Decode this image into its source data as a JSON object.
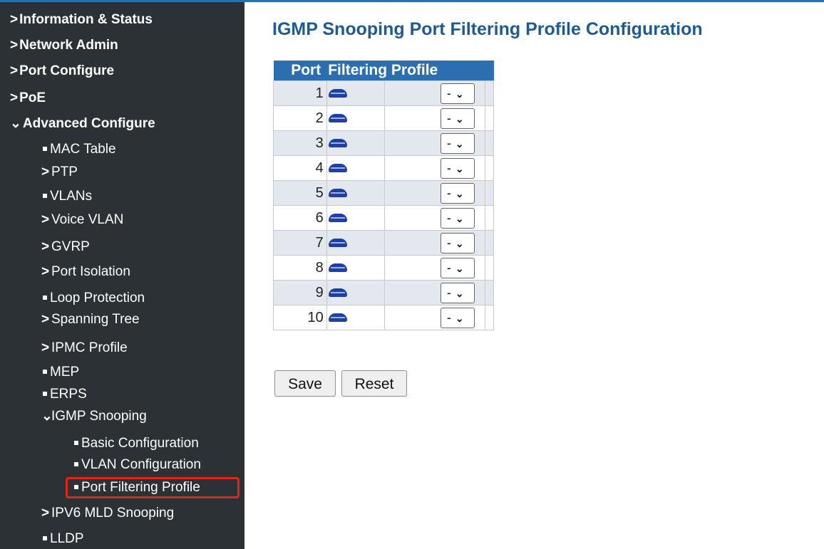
{
  "page_title": "IGMP Snooping Port Filtering Profile Configuration",
  "table": {
    "headers": [
      "Port",
      "Filtering Profile"
    ],
    "rows": [
      {
        "port": "1",
        "profile": "-"
      },
      {
        "port": "2",
        "profile": "-"
      },
      {
        "port": "3",
        "profile": "-"
      },
      {
        "port": "4",
        "profile": "-"
      },
      {
        "port": "5",
        "profile": "-"
      },
      {
        "port": "6",
        "profile": "-"
      },
      {
        "port": "7",
        "profile": "-"
      },
      {
        "port": "8",
        "profile": "-"
      },
      {
        "port": "9",
        "profile": "-"
      },
      {
        "port": "10",
        "profile": "-"
      }
    ]
  },
  "buttons": {
    "save": "Save",
    "reset": "Reset"
  },
  "sidebar": {
    "items": [
      {
        "label": "Information & Status",
        "level": 0,
        "marker": "chevron-right",
        "selected": false
      },
      {
        "label": "Network Admin",
        "level": 0,
        "marker": "chevron-right",
        "selected": false
      },
      {
        "label": "Port Configure",
        "level": 0,
        "marker": "chevron-right",
        "selected": false
      },
      {
        "label": "PoE",
        "level": 0,
        "marker": "chevron-right",
        "selected": false
      },
      {
        "label": "Advanced Configure",
        "level": 0,
        "marker": "chevron-down",
        "selected": false
      },
      {
        "label": "MAC Table",
        "level": 1,
        "marker": "bullet",
        "selected": false
      },
      {
        "label": "PTP",
        "level": 1,
        "marker": "chevron-right",
        "selected": false
      },
      {
        "label": "VLANs",
        "level": 1,
        "marker": "bullet",
        "selected": false
      },
      {
        "label": "Voice VLAN",
        "level": 1,
        "marker": "chevron-right",
        "selected": false
      },
      {
        "label": "GVRP",
        "level": 1,
        "marker": "chevron-right",
        "selected": false
      },
      {
        "label": "Port Isolation",
        "level": 1,
        "marker": "chevron-right",
        "selected": false
      },
      {
        "label": "Loop Protection",
        "level": 1,
        "marker": "bullet",
        "selected": false
      },
      {
        "label": "Spanning Tree",
        "level": 1,
        "marker": "chevron-right",
        "selected": false
      },
      {
        "label": "IPMC Profile",
        "level": 1,
        "marker": "chevron-right",
        "selected": false
      },
      {
        "label": "MEP",
        "level": 1,
        "marker": "bullet",
        "selected": false
      },
      {
        "label": "ERPS",
        "level": 1,
        "marker": "bullet",
        "selected": false
      },
      {
        "label": "IGMP Snooping",
        "level": 1,
        "marker": "chevron-down",
        "selected": false
      },
      {
        "label": "Basic Configuration",
        "level": 2,
        "marker": "bullet",
        "selected": false
      },
      {
        "label": "VLAN Configuration",
        "level": 2,
        "marker": "bullet",
        "selected": false
      },
      {
        "label": "Port Filtering Profile",
        "level": 2,
        "marker": "bullet",
        "selected": true
      },
      {
        "label": "IPV6 MLD Snooping",
        "level": 1,
        "marker": "chevron-right",
        "selected": false
      },
      {
        "label": "LLDP",
        "level": 1,
        "marker": "bullet",
        "selected": false
      }
    ]
  },
  "colors": {
    "sidebar_bg": "#2b3134",
    "accent_blue": "#2c6fb0",
    "title_blue": "#1e5b94",
    "row_alt": "#e3e8ef",
    "highlight_red": "#e0251b"
  }
}
